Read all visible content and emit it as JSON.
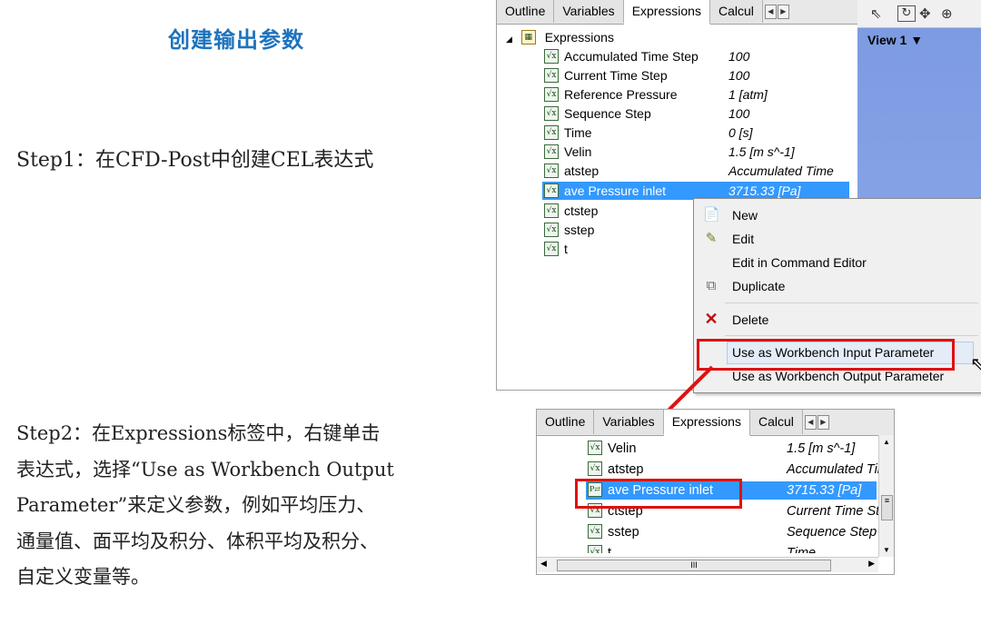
{
  "slide": {
    "title": "创建输出参数",
    "step1": "Step1：在CFD-Post中创建CEL表达式",
    "step2": "Step2：在Expressions标签中，右键单击\n表达式，选择“Use as Workbench Output\nParameter”来定义参数，例如平均压力、\n通量值、面平均及积分、体积平均及积分、\n自定义变量等。"
  },
  "top_panel": {
    "tabs": [
      "Outline",
      "Variables",
      "Expressions",
      "Calcul"
    ],
    "active_tab": "Expressions",
    "root": "Expressions",
    "rows": [
      {
        "name": "Accumulated Time Step",
        "value": "100"
      },
      {
        "name": "Current Time Step",
        "value": "100"
      },
      {
        "name": "Reference Pressure",
        "value": "1 [atm]"
      },
      {
        "name": "Sequence Step",
        "value": "100"
      },
      {
        "name": "Time",
        "value": "0 [s]"
      },
      {
        "name": "Velin",
        "value": "1.5 [m s^-1]"
      },
      {
        "name": "atstep",
        "value": "Accumulated Time"
      },
      {
        "name": "ave Pressure inlet",
        "value": "3715.33 [Pa]"
      },
      {
        "name": "ctstep",
        "value": ""
      },
      {
        "name": "sstep",
        "value": ""
      },
      {
        "name": "t",
        "value": ""
      }
    ]
  },
  "viewer": {
    "view_label": "View 1 ▼"
  },
  "context_menu": {
    "items": {
      "new": "New",
      "edit": "Edit",
      "edit_cmd": "Edit in Command Editor",
      "duplicate": "Duplicate",
      "delete": "Delete",
      "use_input": "Use as Workbench Input Parameter",
      "use_output": "Use as Workbench Output Parameter"
    }
  },
  "bottom_panel": {
    "tabs": [
      "Outline",
      "Variables",
      "Expressions",
      "Calcul"
    ],
    "rows": [
      {
        "name": "Velin",
        "value": "1.5 [m s^-1]"
      },
      {
        "name": "atstep",
        "value": "Accumulated Tir"
      },
      {
        "name": "ave Pressure inlet",
        "value": "3715.33 [Pa]"
      },
      {
        "name": "ctstep",
        "value": "Current Time St"
      },
      {
        "name": "sstep",
        "value": "Sequence Step"
      },
      {
        "name": "t",
        "value": "Time"
      }
    ],
    "hscroll_label": "III"
  },
  "colors": {
    "title_blue": "#1e73be",
    "highlight": "#3399ff",
    "red": "#e01010",
    "viewport": "#7d9be2"
  },
  "icons": [
    "expression-icon",
    "folder-icon",
    "new-icon",
    "edit-icon",
    "duplicate-icon",
    "delete-icon",
    "mouse-cursor-icon"
  ]
}
